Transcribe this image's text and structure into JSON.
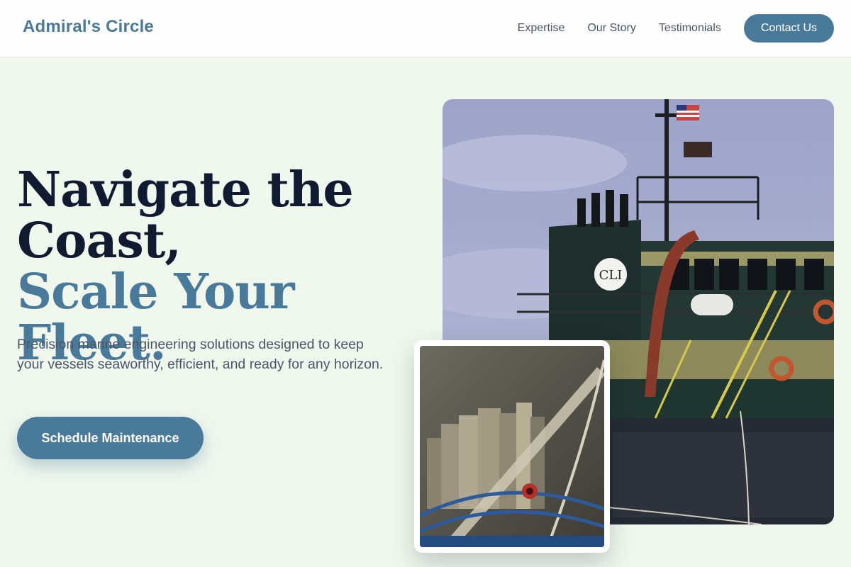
{
  "brand": {
    "name": "Admiral's Circle"
  },
  "nav": {
    "links": [
      "Expertise",
      "Our Story",
      "Testimonials"
    ],
    "cta": "Contact Us"
  },
  "hero": {
    "line1": "Navigate the",
    "line2": "Coast,",
    "accent": "Scale Your Fleet.",
    "description": "Precision marine engineering solutions designed to keep your vessels seaworthy, efficient, and ready for any horizon.",
    "cta": "Schedule Maintenance"
  },
  "images": {
    "main_emblem": "CLI"
  },
  "colors": {
    "accent": "#4a7a9a",
    "heading": "#101a30",
    "background": "#f0f8ee"
  }
}
